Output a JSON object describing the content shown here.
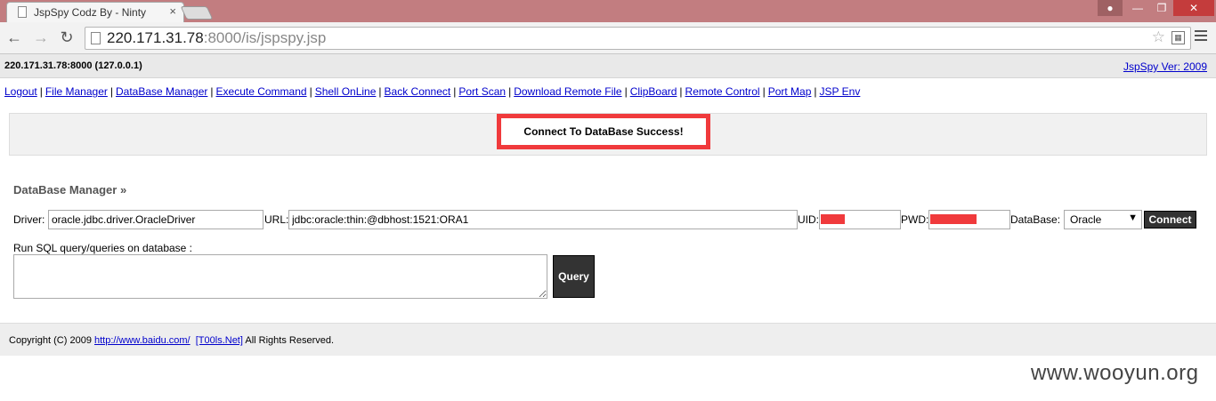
{
  "browser": {
    "tab_title": "JspSpy Codz By - Ninty",
    "tab_close": "×",
    "url_host": "220.171.31.78",
    "url_rest": ":8000/is/jspspy.jsp"
  },
  "header": {
    "host_info": "220.171.31.78:8000 (127.0.0.1)",
    "version_link": "JspSpy Ver: 2009"
  },
  "nav": {
    "links": [
      "Logout",
      "File Manager",
      "DataBase Manager",
      "Execute Command",
      "Shell OnLine",
      "Back Connect",
      "Port Scan",
      "Download Remote File",
      "ClipBoard",
      "Remote Control",
      "Port Map",
      "JSP Env"
    ],
    "separator": "|"
  },
  "message": "Connect To DataBase Success!",
  "db_manager": {
    "title": "DataBase Manager »",
    "driver_label": "Driver:",
    "driver_value": "oracle.jdbc.driver.OracleDriver",
    "url_label": "URL:",
    "url_value": "jdbc:oracle:thin:@dbhost:1521:ORA1",
    "uid_label": "UID:",
    "pwd_label": "PWD:",
    "database_label": "DataBase:",
    "database_selected": "Oracle",
    "connect_label": "Connect",
    "sql_label": "Run SQL query/queries on database :",
    "query_label": "Query"
  },
  "footer": {
    "copyright_prefix": "Copyright (C) 2009",
    "link1": "http://www.baidu.com/",
    "link2": "[T00ls.Net]",
    "suffix": "All Rights Reserved."
  },
  "watermark": "www.wooyun.org",
  "colors": {
    "titlebar": "#c27d80",
    "highlight_red": "#f03a3c",
    "link_blue": "#0000cc",
    "dark_button": "#333333"
  }
}
